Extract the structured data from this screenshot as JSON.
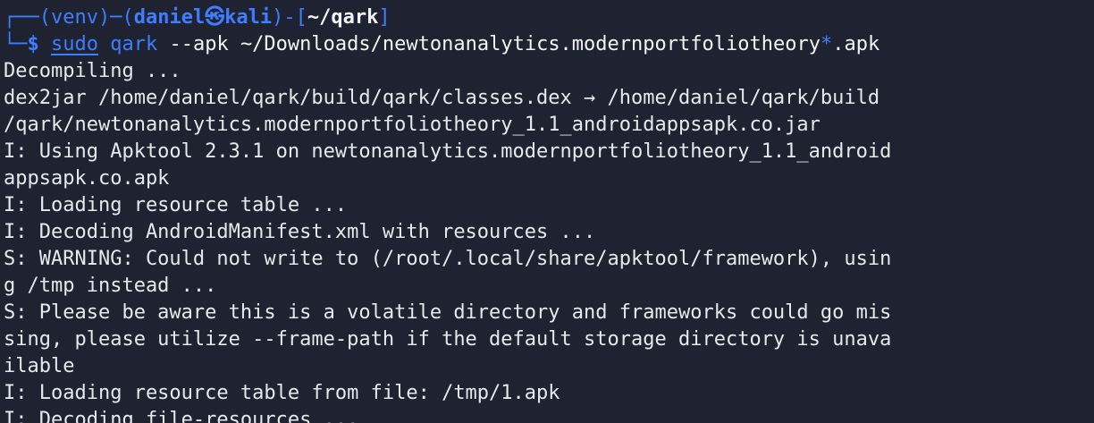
{
  "prompt": {
    "line1_prefix": "┌──(",
    "venv": "venv",
    "sep1": ")─(",
    "user_host": "daniel㉿kali",
    "sep2": ")-[",
    "cwd": "~/qark",
    "close": "]",
    "line2_prefix": "└─",
    "dollar": "$",
    "sudo": "sudo",
    "command": "qark",
    "args_1": "--apk ~/Downloads/newtonanalytics.modernportfoliotheory",
    "glob": "*",
    "args_2": ".apk"
  },
  "output_lines": [
    "Decompiling ...",
    "dex2jar /home/daniel/qark/build/qark/classes.dex → /home/daniel/qark/build",
    "/qark/newtonanalytics.modernportfoliotheory_1.1_androidappsapk.co.jar",
    "I: Using Apktool 2.3.1 on newtonanalytics.modernportfoliotheory_1.1_android",
    "appsapk.co.apk",
    "I: Loading resource table ...",
    "I: Decoding AndroidManifest.xml with resources ...",
    "S: WARNING: Could not write to (/root/.local/share/apktool/framework), usin",
    "g /tmp instead ...",
    "S: Please be aware this is a volatile directory and frameworks could go mis",
    "sing, please utilize --frame-path if the default storage directory is unava",
    "ilable",
    "I: Loading resource table from file: /tmp/1.apk",
    "I: Decoding file-resources ..."
  ],
  "colors": {
    "background": "#1f2331",
    "prompt_blue": "#3f7dff",
    "text": "#e6e8ee"
  }
}
